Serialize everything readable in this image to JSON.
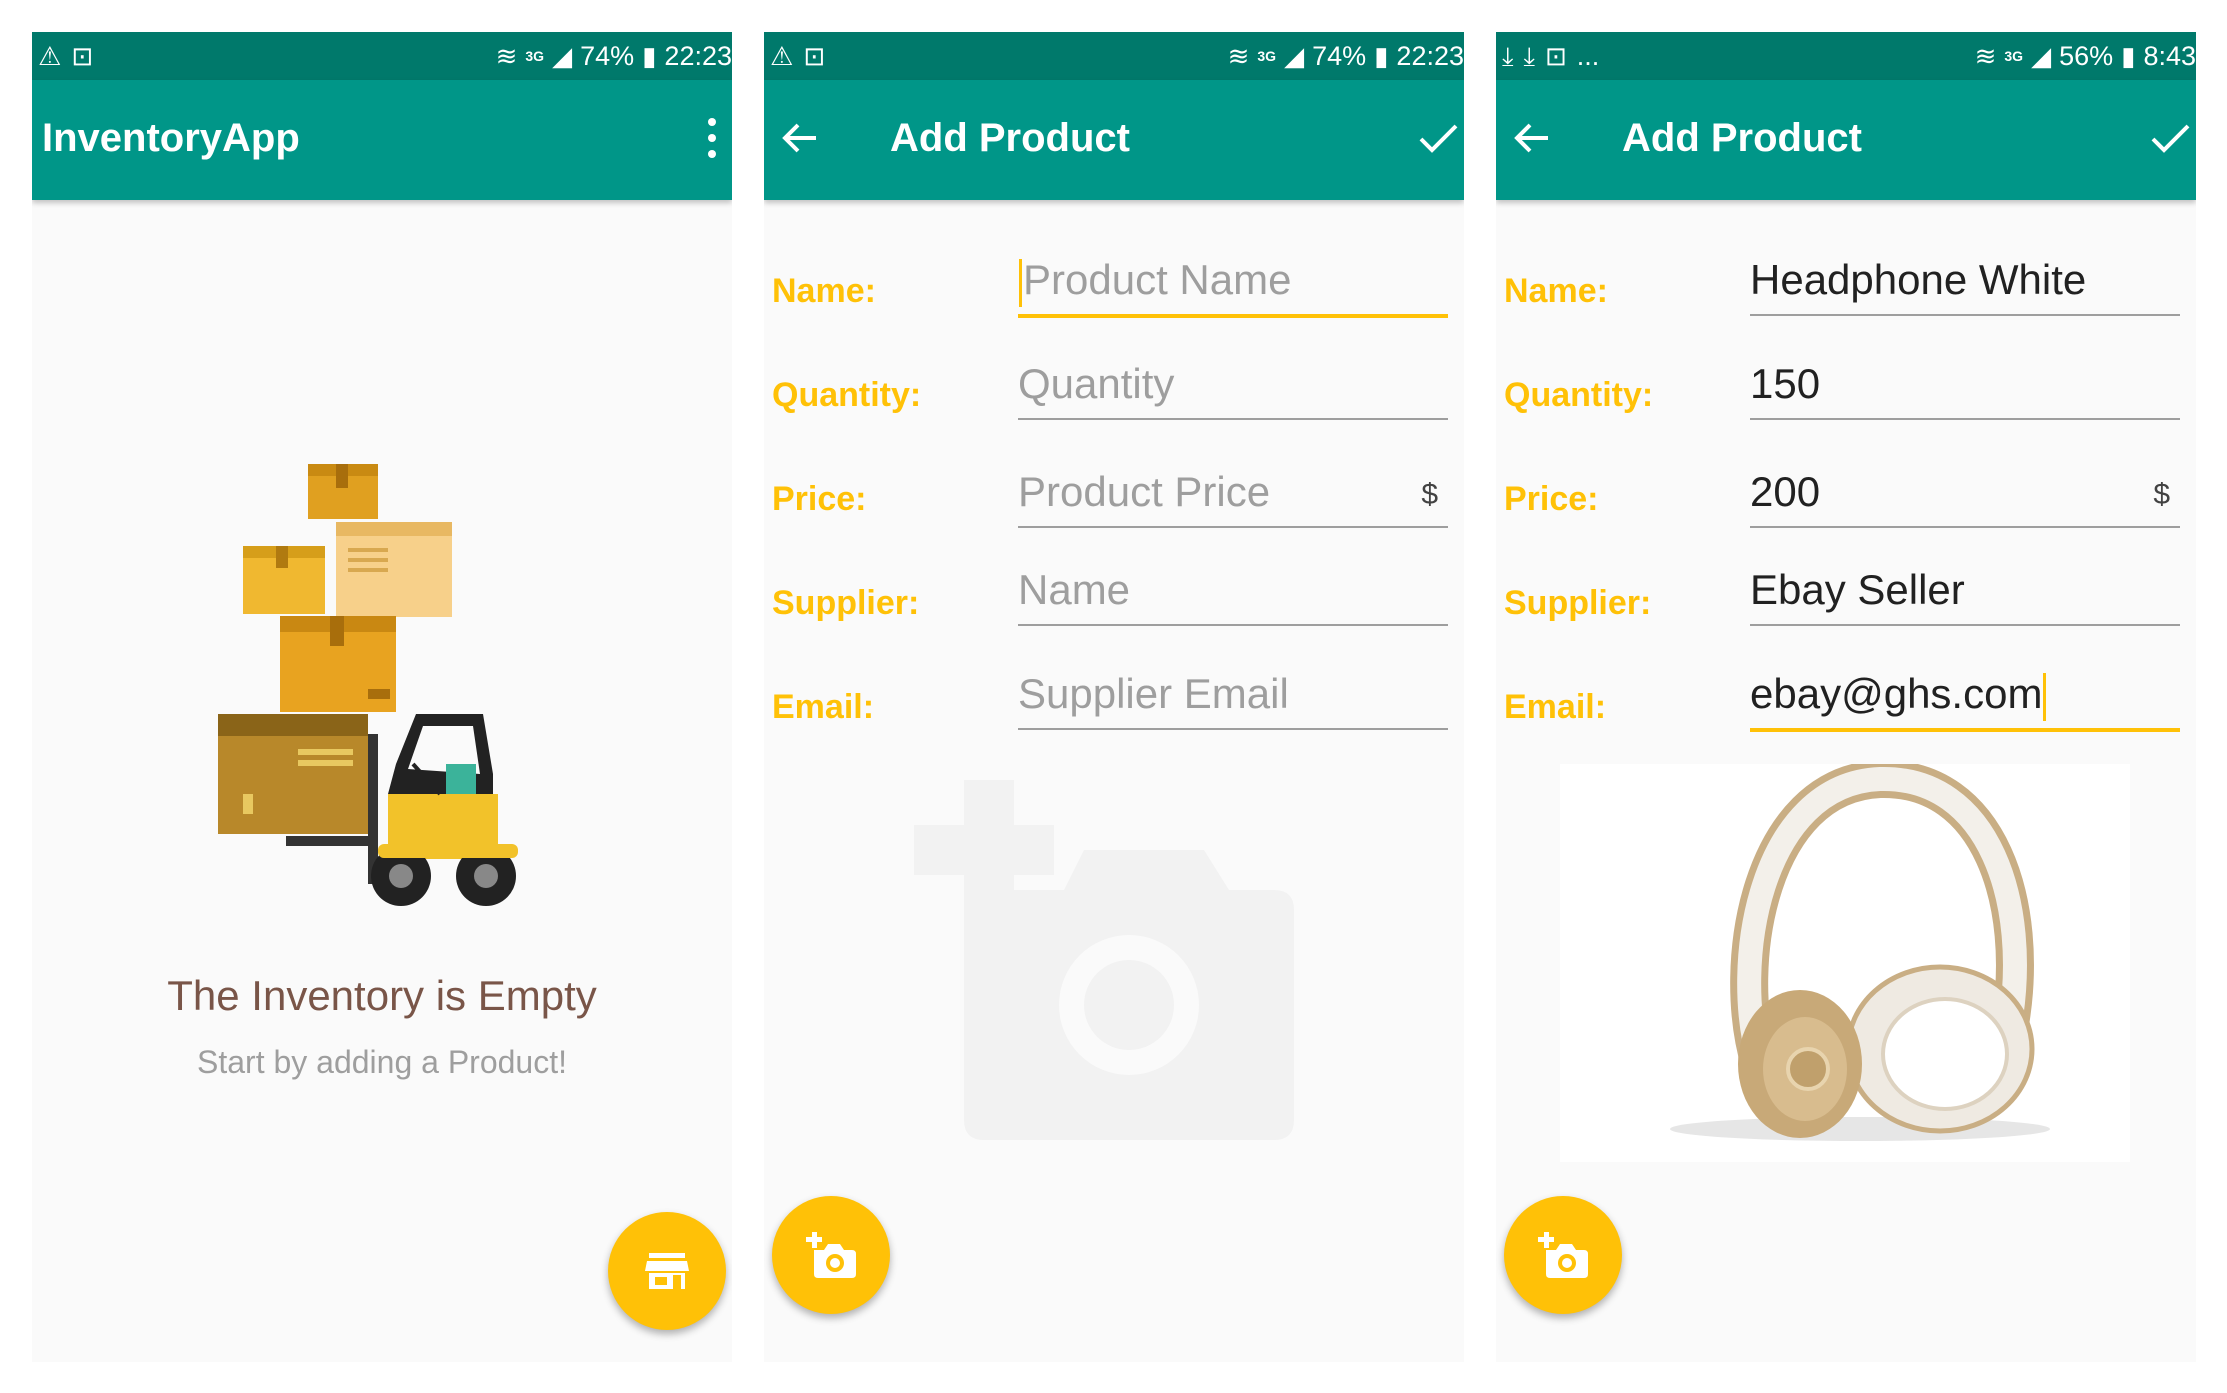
{
  "colors": {
    "status_bar": "#00796b",
    "app_bar": "#009688",
    "accent": "#ffc107",
    "empty_title": "#795548",
    "secondary_text": "#9e9e9e"
  },
  "screens": [
    {
      "status": {
        "battery": "74%",
        "time": "22:23",
        "network": "3G"
      },
      "app_title": "InventoryApp",
      "empty_title": "The Inventory is Empty",
      "empty_subtitle": "Start by adding a Product!",
      "fab_icon": "store-icon"
    },
    {
      "status": {
        "battery": "74%",
        "time": "22:23",
        "network": "3G"
      },
      "title": "Add Product",
      "fields": {
        "name": {
          "label": "Name:",
          "placeholder": "Product Name",
          "value": ""
        },
        "quantity": {
          "label": "Quantity:",
          "placeholder": "Quantity",
          "value": ""
        },
        "price": {
          "label": "Price:",
          "placeholder": "Product Price",
          "value": "",
          "unit": "$"
        },
        "supplier": {
          "label": "Supplier:",
          "placeholder": "Name",
          "value": ""
        },
        "email": {
          "label": "Email:",
          "placeholder": "Supplier Email",
          "value": ""
        }
      },
      "fab_icon": "add-photo-icon"
    },
    {
      "status": {
        "battery": "56%",
        "time": "8:43",
        "network": "3G",
        "extra": "..."
      },
      "title": "Add Product",
      "fields": {
        "name": {
          "label": "Name:",
          "value": "Headphone White"
        },
        "quantity": {
          "label": "Quantity:",
          "value": "150"
        },
        "price": {
          "label": "Price:",
          "value": "200",
          "unit": "$"
        },
        "supplier": {
          "label": "Supplier:",
          "value": "Ebay Seller"
        },
        "email": {
          "label": "Email:",
          "value": "ebay@ghs.com"
        }
      },
      "fab_icon": "add-photo-icon"
    }
  ]
}
